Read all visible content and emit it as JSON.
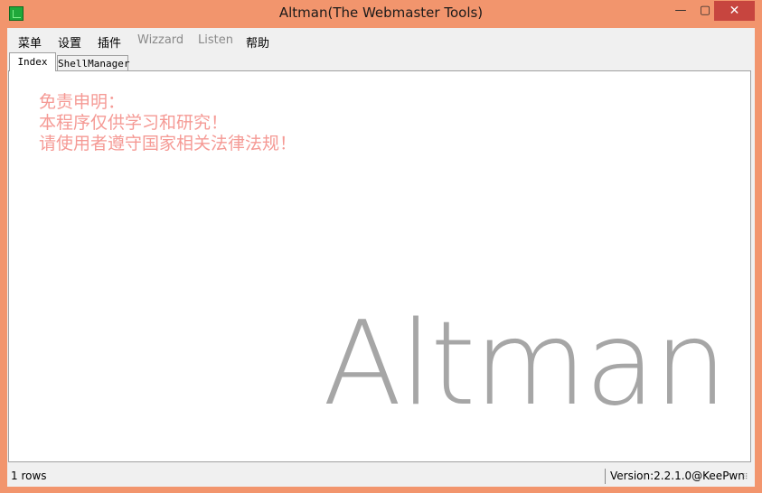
{
  "window": {
    "title": "Altman(The Webmaster Tools)",
    "accent_color": "#f2956d",
    "close_color": "#c7453f",
    "controls": {
      "minimize_icon": "minimize-icon",
      "maximize_icon": "maximize-icon",
      "close_icon": "close-icon",
      "minimize_glyph": "—",
      "maximize_glyph": "▢",
      "close_glyph": "✕"
    }
  },
  "menu": {
    "items": [
      {
        "label": "菜单",
        "enabled": true
      },
      {
        "label": "设置",
        "enabled": true
      },
      {
        "label": "插件",
        "enabled": true
      },
      {
        "label": "Wizzard",
        "enabled": false
      },
      {
        "label": "Listen",
        "enabled": false
      },
      {
        "label": "帮助",
        "enabled": true
      }
    ]
  },
  "tabs": [
    {
      "label": "Index",
      "active": true
    },
    {
      "label": "ShellManager",
      "active": false
    }
  ],
  "main": {
    "disclaimer": {
      "line1": "免责申明：",
      "line2": "本程序仅供学习和研究！",
      "line3": "请使用者遵守国家相关法律法规！",
      "color": "#f59a95"
    },
    "logo_text": "Altman",
    "logo_color": "#a6a6a6"
  },
  "status": {
    "rows": "1 rows",
    "version": "Version:2.2.1.0@KeePwn",
    "grip_icon": "resize-grip-icon"
  }
}
